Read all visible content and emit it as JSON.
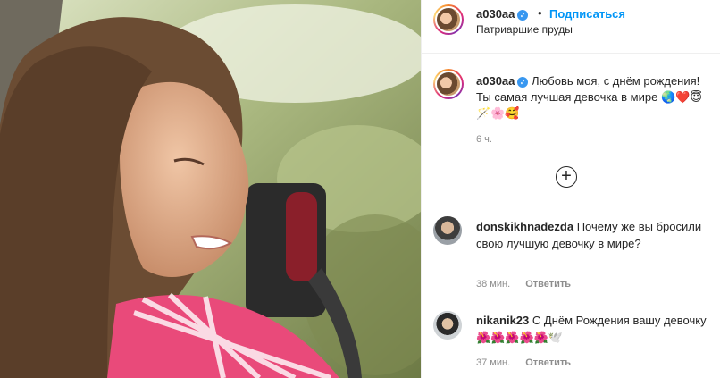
{
  "header": {
    "username": "a030aa",
    "separator": "•",
    "follow_label": "Подписаться",
    "location": "Патриаршие пруды"
  },
  "caption": {
    "username": "a030aa",
    "text": "Любовь моя, с днём рождения! Ты самая лучшая девочка в мире 🌏❤️😇🪄🌸🥰",
    "time": "6 ч."
  },
  "load_more_icon": "plus-circle-icon",
  "comments": [
    {
      "username": "donskikhnadezda",
      "text": "Почему же вы бросили свою лучшую девочку в мире?",
      "time": "38 мин.",
      "reply_label": "Ответить"
    },
    {
      "username": "nikanik23",
      "text": "С Днём Рождения вашу девочку🌺🌺🌺🌺🌺🕊️",
      "time": "37 мин.",
      "reply_label": "Ответить"
    }
  ],
  "colors": {
    "follow": "#0095f6",
    "verified": "#3897f0",
    "muted": "#8e8e8e",
    "text": "#262626"
  }
}
